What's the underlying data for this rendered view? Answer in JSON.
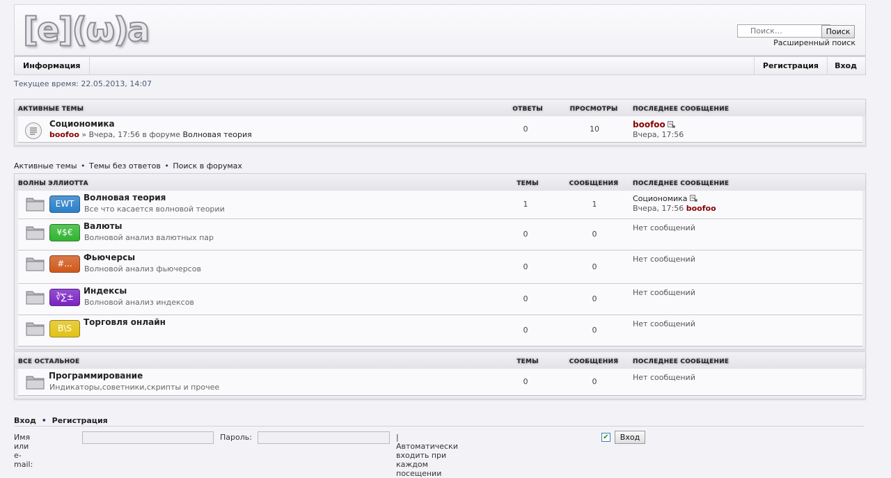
{
  "header": {
    "logo_text": "[e](ω)a",
    "search_placeholder": "Поиск…",
    "search_button": "Поиск",
    "advanced_search": "Расширенный поиск"
  },
  "nav": {
    "info": "Информация",
    "register": "Регистрация",
    "login": "Вход"
  },
  "current_time": "Текущее время: 22.05.2013, 14:07",
  "active_topics": {
    "heading": "Активные темы",
    "col_replies": "Ответы",
    "col_views": "Просмотры",
    "col_last": "Последнее сообщение",
    "rows": [
      {
        "title": "Социономика",
        "author": "boofoo",
        "meta": " » Вчера, 17:56 в форуме ",
        "forum": "Волновая теория",
        "replies": "0",
        "views": "10",
        "last_author": "boofoo",
        "last_time": "Вчера, 17:56"
      }
    ]
  },
  "quick_links": {
    "active": "Активные темы",
    "unanswered": "Темы без ответов",
    "search": "Поиск в форумах",
    "separator": "•"
  },
  "category_waves": {
    "heading": "Волны Эллиотта",
    "col_topics": "Темы",
    "col_posts": "Сообщения",
    "col_last": "Последнее сообщение",
    "forums": [
      {
        "badge": "EWT",
        "badge_color": "#2a7fc8",
        "title": "Волновая теория",
        "desc": "Все что касается волновой теории",
        "topics": "1",
        "posts": "1",
        "last_topic": "Социономика",
        "last_time": "Вчера, 17:56",
        "last_author": "boofoo"
      },
      {
        "badge": "¥$€",
        "badge_color": "#2fb52f",
        "title": "Валюты",
        "desc": "Волновой анализ валютных пар",
        "topics": "0",
        "posts": "0",
        "last_text": "Нет сообщений"
      },
      {
        "badge": "#...",
        "badge_color": "#d0581a",
        "title": "Фьючерсы",
        "desc": "Волновой анализ фьючерсов",
        "topics": "0",
        "posts": "0",
        "last_text": "Нет сообщений"
      },
      {
        "badge": "∛∑±",
        "badge_color": "#7a22c2",
        "title": "Индексы",
        "desc": "Волновой анализ индексов",
        "topics": "0",
        "posts": "0",
        "last_text": "Нет сообщений"
      },
      {
        "badge": "B\\S",
        "badge_color": "#e2c214",
        "title": "Торговля онлайн",
        "desc": "",
        "topics": "0",
        "posts": "0",
        "last_text": "Нет сообщений"
      }
    ]
  },
  "category_other": {
    "heading": "Все остальное",
    "col_topics": "Темы",
    "col_posts": "Сообщения",
    "col_last": "Последнее сообщение",
    "forums": [
      {
        "title": "Программирование",
        "desc": "Индикаторы,советники,скрипты и прочее",
        "topics": "0",
        "posts": "0",
        "last_text": "Нет сообщений"
      }
    ]
  },
  "login": {
    "heading_login": "Вход",
    "heading_sep": "•",
    "heading_register": "Регистрация",
    "username_label": "Имя или e-mail:",
    "password_label": "Пароль:",
    "autologin_label": "| Автоматически входить при каждом посещении",
    "autologin_checked": true,
    "submit": "Вход"
  }
}
